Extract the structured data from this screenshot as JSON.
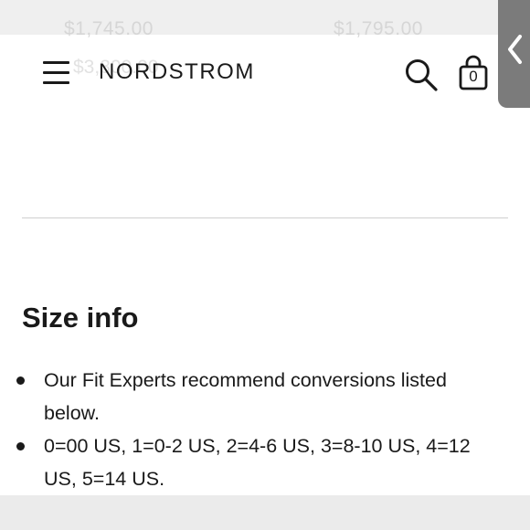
{
  "ghost": {
    "price_left": "$1,745.00",
    "price_right": "$1,795.00",
    "price_left_2": "$3,300.00"
  },
  "header": {
    "logo": "NORDSTROM",
    "bag_count": "0"
  },
  "icons": {
    "menu": "hamburger-menu-icon",
    "search": "search-icon",
    "bag": "shopping-bag-icon",
    "collapse": "chevron-left-icon"
  },
  "size_info": {
    "title": "Size info",
    "bullets": [
      "Our Fit Experts recommend conversions listed below.",
      "0=00 US, 1=0-2 US, 2=4-6 US, 3=8-10 US, 4=12 US, 5=14 US."
    ]
  },
  "colors": {
    "text": "#1a1a1a",
    "divider": "#cfcfcf",
    "side_tab": "#7b7b7b"
  }
}
